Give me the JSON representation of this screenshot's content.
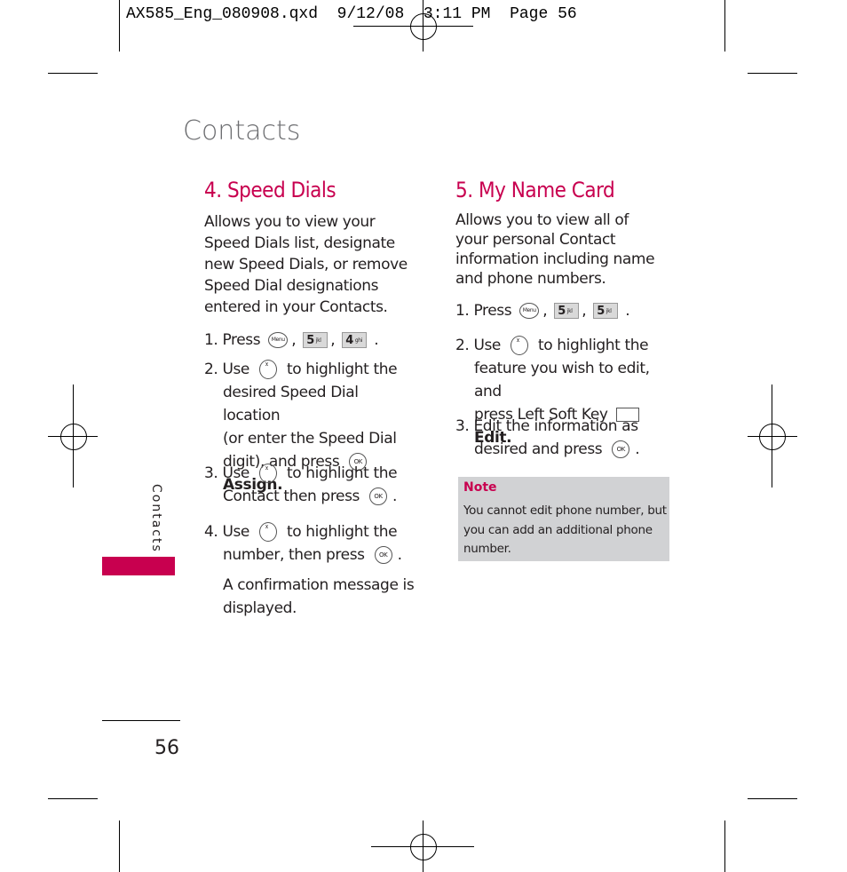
{
  "slug": "AX585_Eng_080908.qxd  9/12/08  3:11 PM  Page 56",
  "page_title": "Contacts",
  "side_tab_label": "Contacts",
  "page_number": "56",
  "brand_color": "#c8004f",
  "speed_dials": {
    "heading": "4. Speed Dials",
    "intro": "Allows you to view your Speed Dials list, designate new Speed Dials, or remove Speed Dial designations entered in your Contacts.",
    "step1": {
      "num": "1.",
      "text": "Press",
      "keys": [
        "Menu",
        "5 jkl",
        "4 ghi"
      ]
    },
    "step2": {
      "num": "2.",
      "a": "Use",
      "b": "to highlight the",
      "c": "desired Speed Dial location",
      "d": "(or enter the Speed Dial",
      "e": "digit), and press",
      "action": "Assign."
    },
    "step3": {
      "num": "3.",
      "a": "Use",
      "b": "to highlight the",
      "c": "Contact then press"
    },
    "step4": {
      "num": "4.",
      "a": "Use",
      "b": "to highlight the",
      "c": "number, then press"
    },
    "confirm1": "A confirmation message is",
    "confirm2": "displayed."
  },
  "name_card": {
    "heading": "5. My Name Card",
    "intro": "Allows you to view all of your personal Contact information including name and phone numbers.",
    "step1": {
      "num": "1.",
      "text": "Press",
      "keys": [
        "Menu",
        "5 jkl",
        "5 jkl"
      ]
    },
    "step2": {
      "num": "2.",
      "a": "Use",
      "b": "to highlight the",
      "c": "feature you wish to edit, and",
      "d": "press Left Soft Key",
      "action": "Edit."
    },
    "step3": {
      "num": "3.",
      "a": "Edit the information as",
      "b": "desired and press"
    }
  },
  "note": {
    "title": "Note",
    "body": "You cannot edit phone number, but you can add an additional phone number."
  },
  "icons": {
    "menu": "Menu",
    "ok": "OK",
    "key5": "5",
    "key5sub": "jkl",
    "key4": "4",
    "key4sub": "ghi"
  }
}
